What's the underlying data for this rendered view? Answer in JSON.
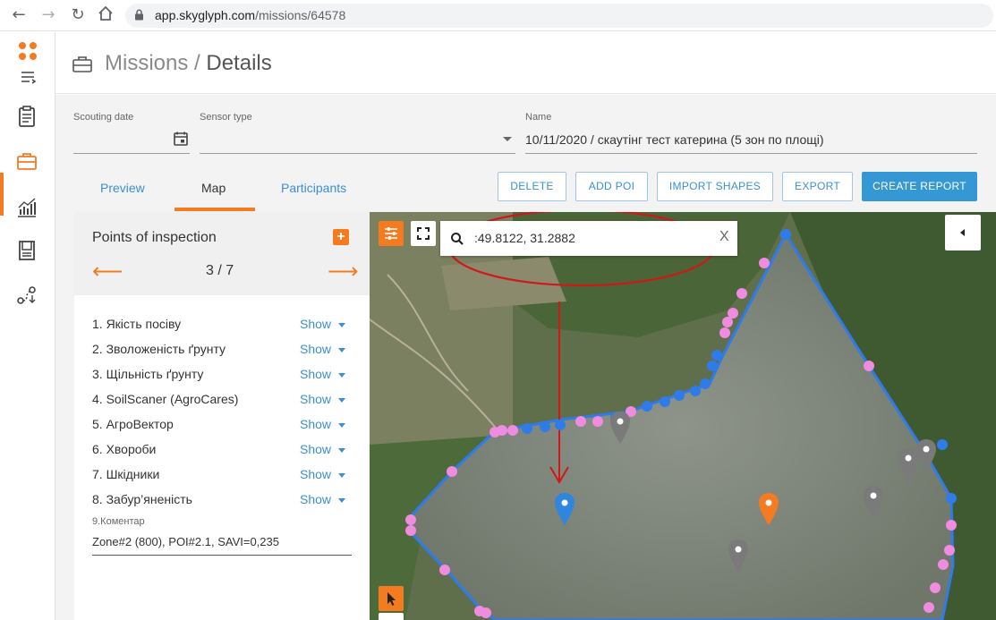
{
  "browser": {
    "url_host": "app.skyglyph.com",
    "url_path": "/missions/64578"
  },
  "header": {
    "title_section": "Missions",
    "title_separator": " / ",
    "title_page": "Details"
  },
  "form": {
    "scouting_date_label": "Scouting date",
    "scouting_date_value": "",
    "sensor_type_label": "Sensor type",
    "sensor_type_value": "",
    "name_label": "Name",
    "name_value": "10/11/2020 / скаутінг тест катерина (5 зон по площі)"
  },
  "tabs": [
    {
      "label": "Preview",
      "active": false
    },
    {
      "label": "Map",
      "active": true
    },
    {
      "label": "Participants",
      "active": false
    }
  ],
  "actions": {
    "delete": "DELETE",
    "add_poi": "ADD POI",
    "import_shapes": "IMPORT SHAPES",
    "export": "EXPORT",
    "create_report": "CREATE REPORT"
  },
  "poi": {
    "title": "Points of inspection",
    "prev_arrow": "⟵",
    "next_arrow": "⟶",
    "page": "3 / 7",
    "add_symbol": "+",
    "items": [
      {
        "label": "1. Якість посіву",
        "action": "Show"
      },
      {
        "label": "2. Зволоженість ґрунту",
        "action": "Show"
      },
      {
        "label": "3. Щільність ґрунту",
        "action": "Show"
      },
      {
        "label": "4. SoilScaner (AgroCares)",
        "action": "Show"
      },
      {
        "label": "5. АгроВектор",
        "action": "Show"
      },
      {
        "label": "6. Хвороби",
        "action": "Show"
      },
      {
        "label": "7. Шкідники",
        "action": "Show"
      },
      {
        "label": "8. Забур’яненість",
        "action": "Show"
      }
    ],
    "comment_label": "9.Коментар",
    "comment_value": "Zone#2 (800), POI#2.1, SAVI=0,235"
  },
  "map": {
    "search_value": ":49.8122, 31.2882",
    "clear_symbol": "X",
    "accent_color": "#f47b20",
    "boundary_color": "#2f7bea",
    "vertex_color": "#f08ce0",
    "annotation_color": "#d01818"
  },
  "colors": {
    "accent": "#f47b20",
    "link": "#3b8fd6",
    "primary_button": "#3597d3"
  }
}
